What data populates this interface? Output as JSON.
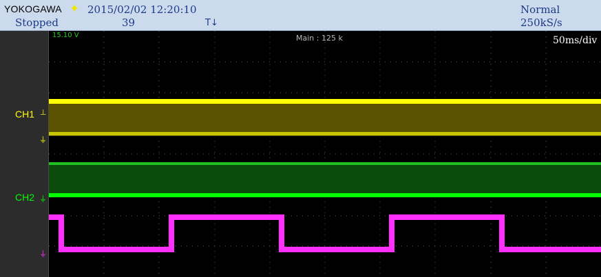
{
  "header": {
    "brand": "YOKOGAWA",
    "brand_icon": "star-icon",
    "datetime": "2015/02/02 12:20:10",
    "run_state": "Stopped",
    "acq_count": "39",
    "trigger_mode": "Normal",
    "sample_rate": "250kS/s",
    "trigger_icon": "trigger-edge-icon"
  },
  "screen": {
    "level_readout": "15.10 V",
    "record_length": "Main : 125 k",
    "timebase": "50ms/div"
  },
  "channels": [
    {
      "label": "CH1",
      "color": "#ffff00",
      "fill": "#5a5200"
    },
    {
      "label": "CH2",
      "color": "#00ff00",
      "fill": "#0a4a0a"
    },
    {
      "label": "",
      "color": "#ff30ff"
    }
  ],
  "colors": {
    "header_bg": "#ccdaee",
    "header_text": "#1c3a86",
    "grid": "#5a5a5a"
  }
}
